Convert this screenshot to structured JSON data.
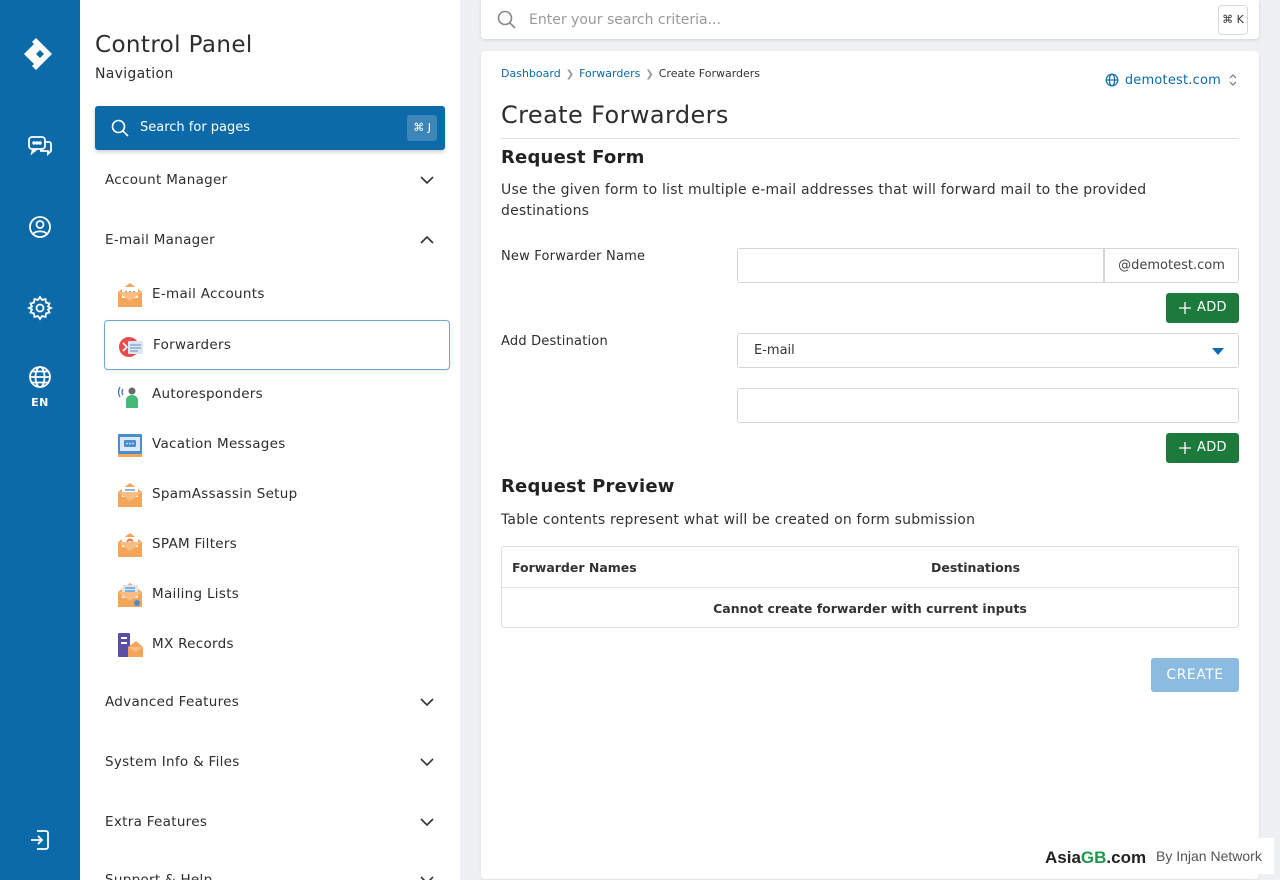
{
  "rail": {
    "language": "EN"
  },
  "sidebar": {
    "title": "Control Panel",
    "subtitle": "Navigation",
    "page_search": {
      "label": "Search for pages",
      "shortcut": "⌘ J"
    },
    "sections": {
      "account_manager": "Account Manager",
      "email_manager": "E-mail Manager",
      "advanced_features": "Advanced Features",
      "system_info": "System Info & Files",
      "extra_features": "Extra Features",
      "support_help": "Support & Help"
    },
    "email_items": [
      {
        "label": "E-mail Accounts",
        "icon": "email-accounts-icon"
      },
      {
        "label": "Forwarders",
        "icon": "forwarders-icon",
        "active": true
      },
      {
        "label": "Autoresponders",
        "icon": "autoresponders-icon"
      },
      {
        "label": "Vacation Messages",
        "icon": "vacation-messages-icon"
      },
      {
        "label": "SpamAssassin Setup",
        "icon": "spamassassin-icon"
      },
      {
        "label": "SPAM Filters",
        "icon": "spam-filters-icon"
      },
      {
        "label": "Mailing Lists",
        "icon": "mailing-lists-icon"
      },
      {
        "label": "MX Records",
        "icon": "mx-records-icon"
      }
    ]
  },
  "topbar": {
    "search_placeholder": "Enter your search criteria...",
    "shortcut": "⌘ K"
  },
  "main": {
    "breadcrumbs": [
      "Dashboard",
      "Forwarders",
      "Create Forwarders"
    ],
    "domain": "demotest.com",
    "title": "Create Forwarders",
    "request_form": {
      "heading": "Request Form",
      "description": "Use the given form to list multiple e-mail addresses that will forward mail to the provided destinations",
      "forwarder_label": "New Forwarder Name",
      "forwarder_value": "",
      "domain_suffix": "@demotest.com",
      "add_label": "ADD",
      "destination_label": "Add Destination",
      "destination_type": "E-mail",
      "destination_value": ""
    },
    "preview": {
      "heading": "Request Preview",
      "description": "Table contents represent what will be created on form submission",
      "col_names": "Forwarder Names",
      "col_destinations": "Destinations",
      "empty_message": "Cannot create forwarder with current inputs"
    },
    "create_label": "CREATE"
  },
  "brand": {
    "name_a": "Asia",
    "name_b": "GB",
    "name_c": ".com",
    "by": "By Injan Network"
  },
  "colors": {
    "primary": "#0d6aa8",
    "add_button": "#1c7a3d",
    "create_disabled": "#8bbbe0"
  }
}
